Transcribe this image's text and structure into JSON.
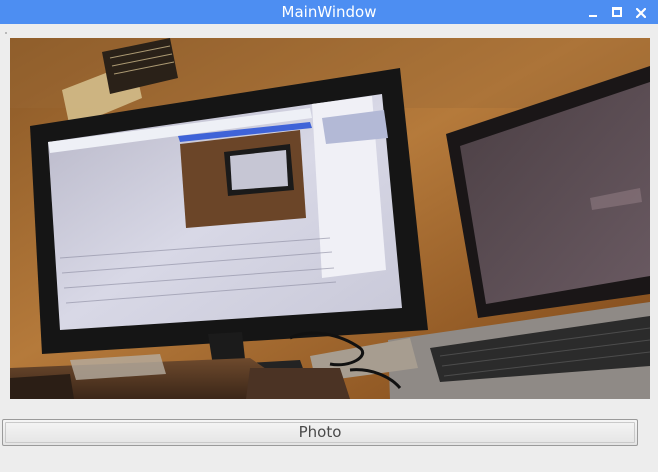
{
  "window": {
    "title": "MainWindow",
    "titlebar_color": "#4d8ef2",
    "controls": {
      "minimize_icon": "minimize-icon",
      "maximize_icon": "maximize-icon",
      "close_icon": "close-icon"
    }
  },
  "camera_view": {
    "content": "camera-preview-image"
  },
  "photo_button": {
    "label": "Photo"
  }
}
